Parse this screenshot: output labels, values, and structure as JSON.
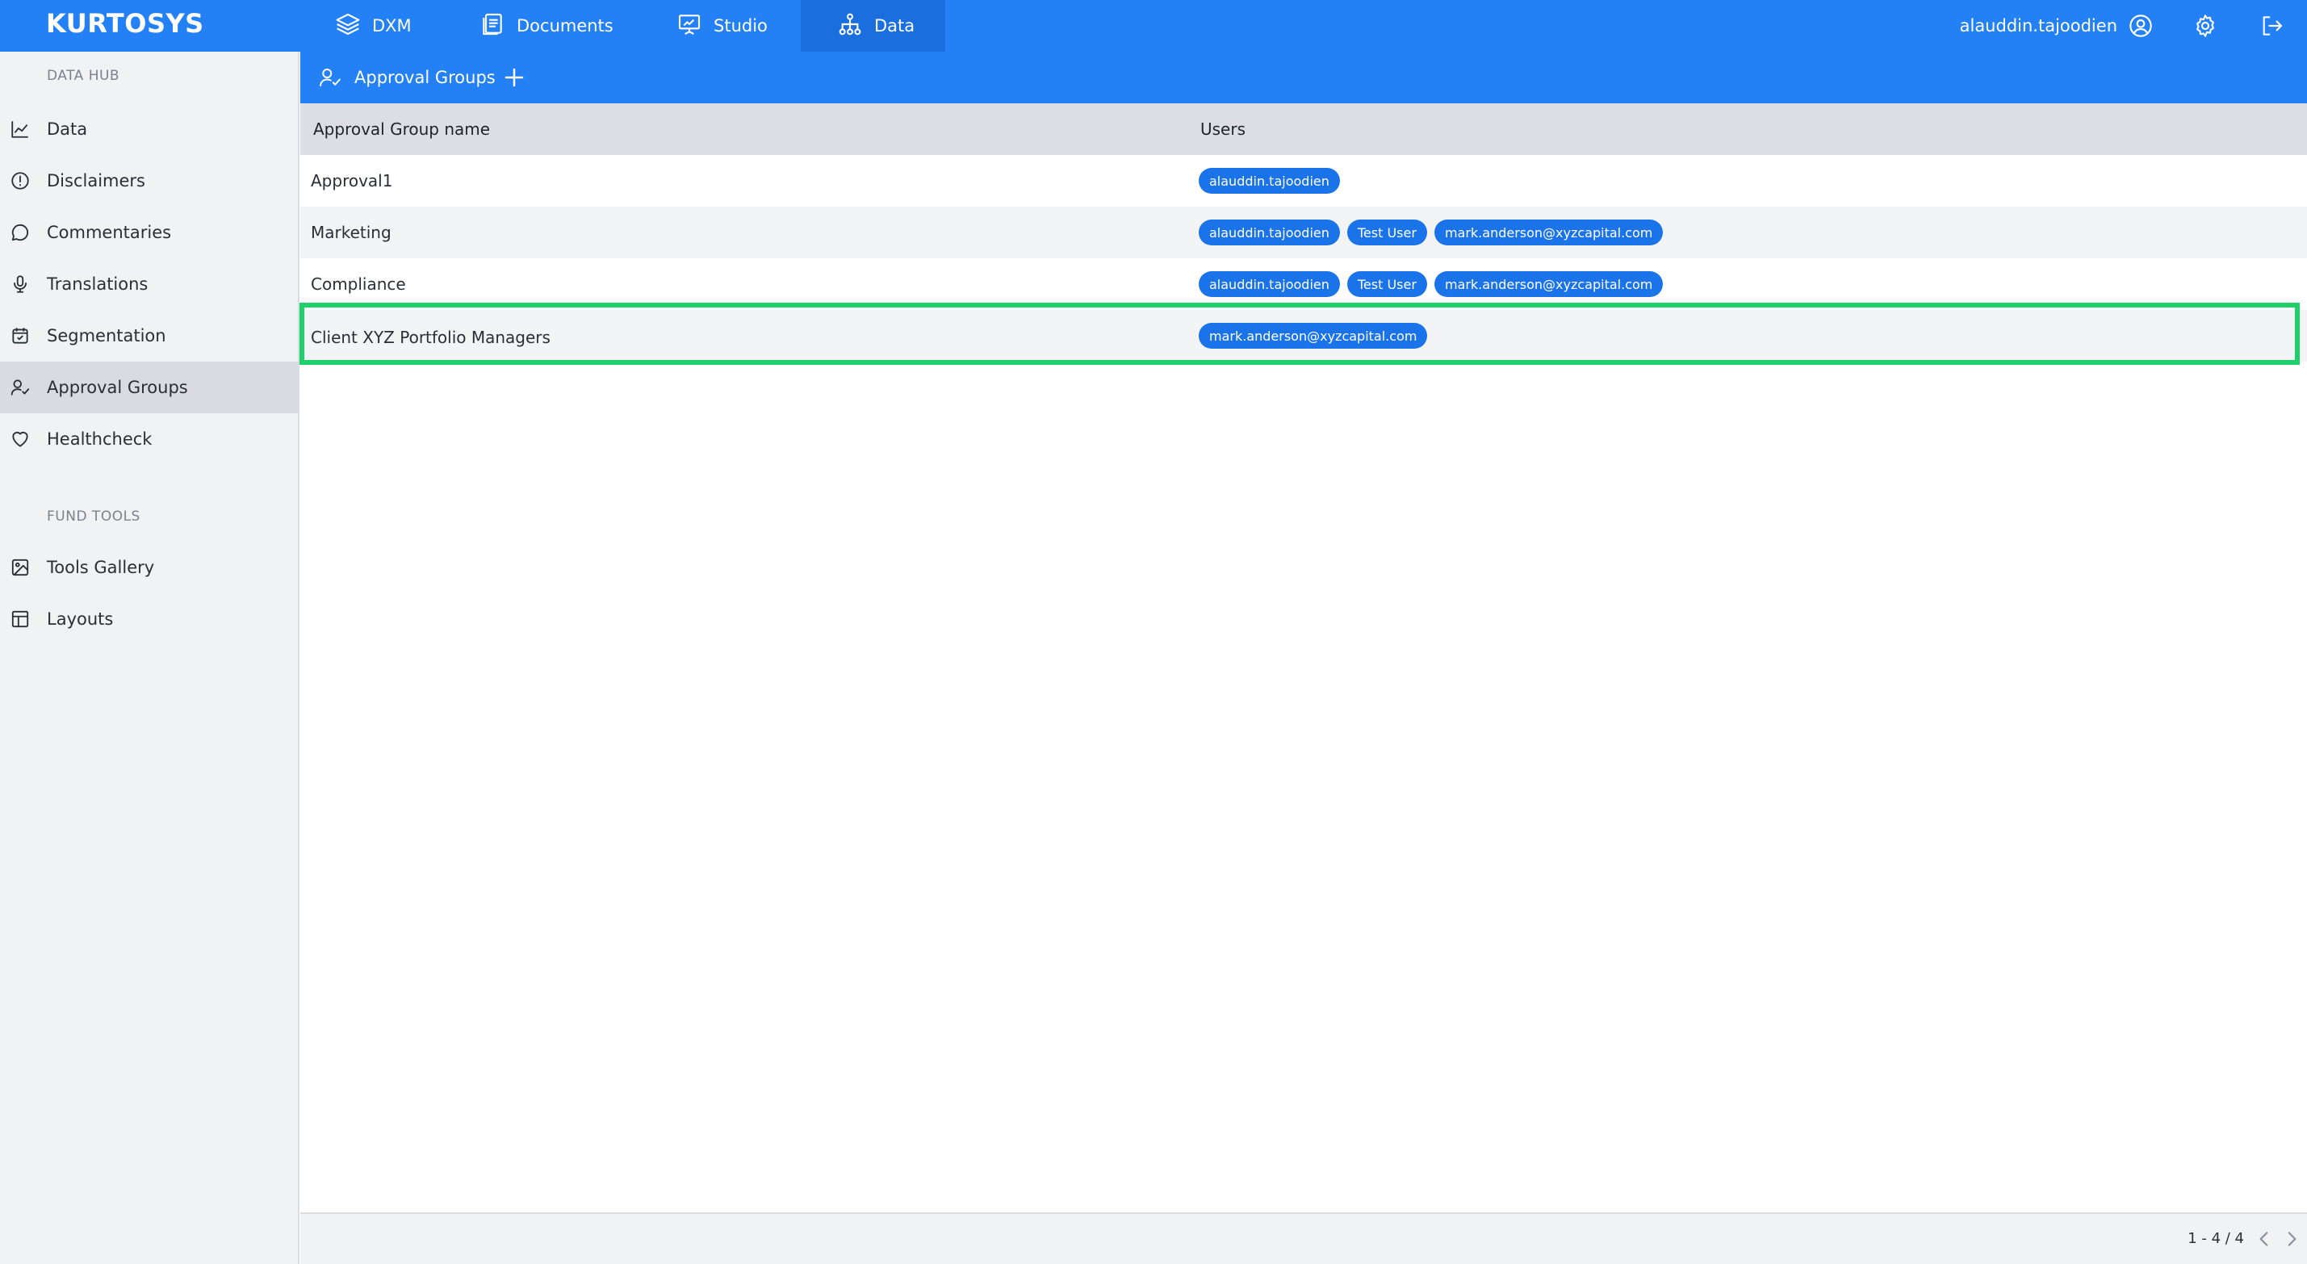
{
  "app": {
    "logo": "KURTOSYS"
  },
  "nav": {
    "tabs": [
      {
        "label": "DXM",
        "icon": "layers-icon"
      },
      {
        "label": "Documents",
        "icon": "documents-icon"
      },
      {
        "label": "Studio",
        "icon": "presentation-icon"
      },
      {
        "label": "Data",
        "icon": "hierarchy-icon",
        "active": true
      }
    ]
  },
  "user": {
    "name": "alauddin.tajoodien"
  },
  "sidebar": {
    "sections": [
      {
        "title": "DATA HUB"
      },
      {
        "title": "FUND TOOLS"
      }
    ],
    "items": [
      {
        "label": "Data",
        "icon": "chart-icon"
      },
      {
        "label": "Disclaimers",
        "icon": "alert-circle-icon"
      },
      {
        "label": "Commentaries",
        "icon": "message-icon"
      },
      {
        "label": "Translations",
        "icon": "microphone-icon"
      },
      {
        "label": "Segmentation",
        "icon": "calendar-icon"
      },
      {
        "label": "Approval Groups",
        "icon": "user-check-icon",
        "active": true
      },
      {
        "label": "Healthcheck",
        "icon": "heart-icon"
      },
      {
        "label": "Tools Gallery",
        "icon": "image-icon"
      },
      {
        "label": "Layouts",
        "icon": "layout-icon"
      }
    ]
  },
  "page": {
    "title": "Approval Groups"
  },
  "table": {
    "columns": [
      "Approval Group name",
      "Users"
    ],
    "rows": [
      {
        "name": "Approval1",
        "users": [
          "alauddin.tajoodien"
        ]
      },
      {
        "name": "Marketing",
        "users": [
          "alauddin.tajoodien",
          "Test User",
          "mark.anderson@xyzcapital.com"
        ]
      },
      {
        "name": "Compliance",
        "users": [
          "alauddin.tajoodien",
          "Test User",
          "mark.anderson@xyzcapital.com"
        ]
      },
      {
        "name": "Client XYZ Portfolio Managers",
        "users": [
          "mark.anderson@xyzcapital.com"
        ],
        "highlighted": true
      }
    ]
  },
  "pagination": {
    "text": "1 - 4 / 4"
  },
  "colors": {
    "primary": "#2381f5",
    "chip": "#1a73e8",
    "highlight": "#1fcf6a"
  }
}
